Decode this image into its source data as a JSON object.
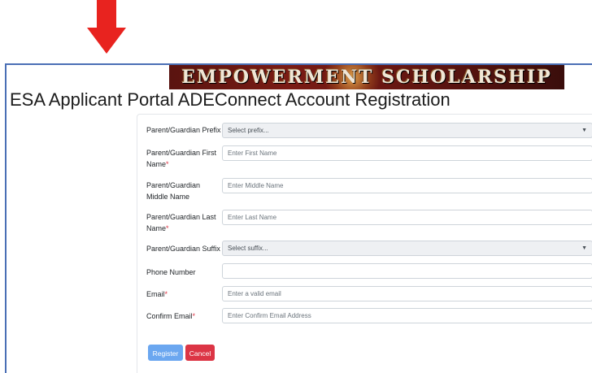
{
  "banner": {
    "text": "EMPOWERMENT SCHOLARSHIP"
  },
  "page": {
    "title": "ESA Applicant Portal ADEConnect Account Registration"
  },
  "form": {
    "required_marker": "*",
    "prefix": {
      "label": "Parent/Guardian Prefix",
      "value": "Select prefix..."
    },
    "first_name": {
      "label": "Parent/Guardian First Name",
      "placeholder": "Enter First Name"
    },
    "middle_name": {
      "label": "Parent/Guardian Middle Name",
      "placeholder": "Enter Middle Name"
    },
    "last_name": {
      "label": "Parent/Guardian Last Name",
      "placeholder": "Enter Last Name"
    },
    "suffix": {
      "label": "Parent/Guardian Suffix",
      "value": "Select suffix..."
    },
    "phone": {
      "label": "Phone Number",
      "placeholder": ""
    },
    "email": {
      "label": "Email",
      "placeholder": "Enter a valid email"
    },
    "confirm_email": {
      "label": "Confirm Email",
      "placeholder": "Enter Confirm Email Address"
    }
  },
  "buttons": {
    "register": "Register",
    "cancel": "Cancel"
  },
  "colors": {
    "accent": "#6ba7f0",
    "danger": "#dc3545",
    "frame": "#4a6fb5",
    "annotation": "#e8231f"
  }
}
